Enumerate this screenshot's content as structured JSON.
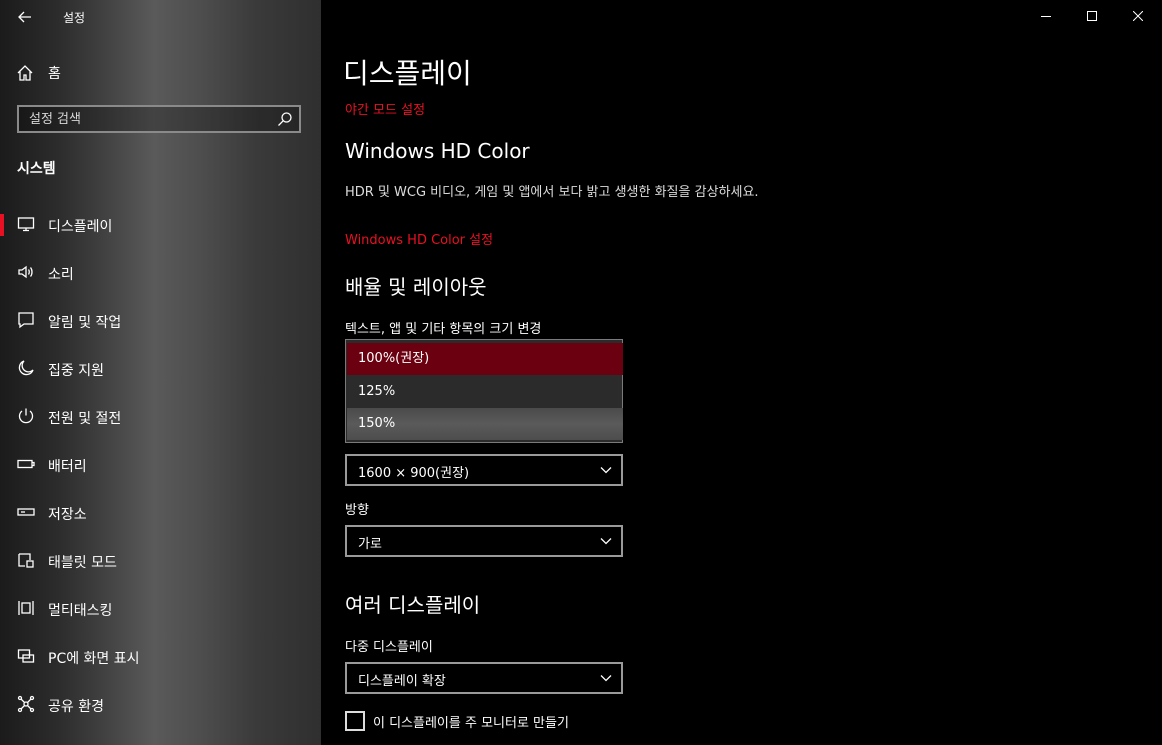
{
  "window": {
    "title": "설정"
  },
  "sidebar": {
    "home_label": "홈",
    "search_placeholder": "설정 검색",
    "section_title": "시스템",
    "items": [
      {
        "label": "디스플레이",
        "icon": "monitor-icon",
        "selected": true
      },
      {
        "label": "소리",
        "icon": "speaker-icon"
      },
      {
        "label": "알림 및 작업",
        "icon": "notification-icon"
      },
      {
        "label": "집중 지원",
        "icon": "moon-icon"
      },
      {
        "label": "전원 및 절전",
        "icon": "power-icon"
      },
      {
        "label": "배터리",
        "icon": "battery-icon"
      },
      {
        "label": "저장소",
        "icon": "storage-icon"
      },
      {
        "label": "태블릿 모드",
        "icon": "tablet-icon"
      },
      {
        "label": "멀티태스킹",
        "icon": "multitasking-icon"
      },
      {
        "label": "PC에 화면 표시",
        "icon": "project-icon"
      },
      {
        "label": "공유 환경",
        "icon": "shared-experience-icon"
      }
    ]
  },
  "main": {
    "page_title": "디스플레이",
    "night_mode_link": "야간 모드 설정",
    "hd_color": {
      "heading": "Windows HD Color",
      "description": "HDR 및 WCG 비디오, 게임 및 앱에서 보다 밝고 생생한 화질을 감상하세요.",
      "link": "Windows HD Color 설정"
    },
    "scale_layout": {
      "heading": "배율 및 레이아웃",
      "scale_label": "텍스트, 앱 및 기타 항목의 크기 변경",
      "scale_options": [
        "100%(권장)",
        "125%",
        "150%"
      ],
      "resolution_value": "1600 × 900(권장)",
      "orientation_label": "방향",
      "orientation_value": "가로"
    },
    "multi_display": {
      "heading": "여러 디스플레이",
      "label": "다중 디스플레이",
      "value": "디스플레이 확장",
      "checkbox_label": "이 디스플레이를 주 모니터로 만들기"
    }
  },
  "colors": {
    "accent": "#e81123",
    "selected_option_bg": "#6b0010"
  }
}
